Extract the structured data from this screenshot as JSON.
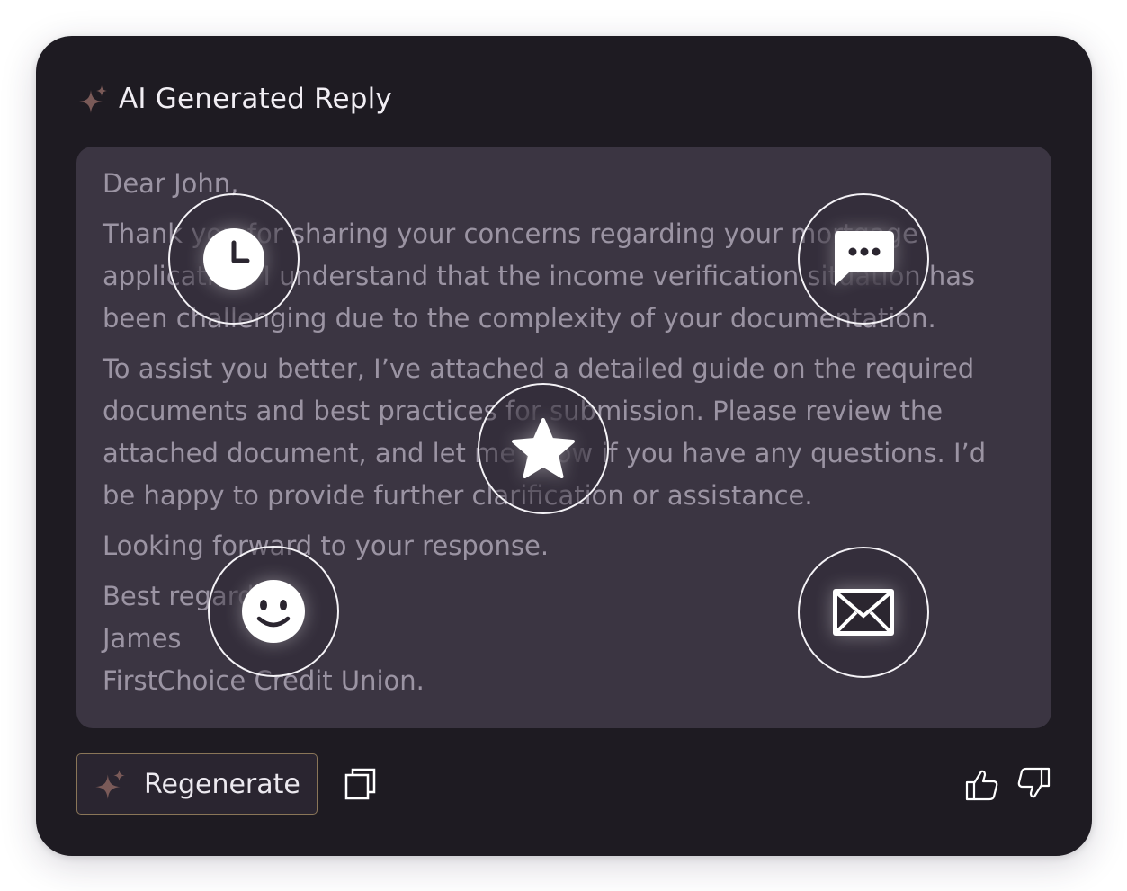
{
  "header": {
    "title": "AI Generated Reply"
  },
  "reply": {
    "greeting": "Dear John,",
    "paragraph_1": "Thank you for sharing your concerns regarding your mortgage application. I understand that the income verification situation has been challenging due to the complexity of your documentation.",
    "paragraph_2": "To assist you better, I’ve attached a detailed guide on the required documents and best practices for submission. Please review the attached document, and let me know if you have any questions. I’d be happy to provide further clarification or assistance.",
    "paragraph_3": "Looking forward to your response.",
    "closing": "Best regards,",
    "sender_name": "James",
    "sender_org": "FirstChoice Credit Union."
  },
  "feature_icons": [
    {
      "name": "clock-icon"
    },
    {
      "name": "chat-bubble-icon"
    },
    {
      "name": "star-icon"
    },
    {
      "name": "smiley-icon"
    },
    {
      "name": "envelope-icon"
    }
  ],
  "footer": {
    "regenerate_label": "Regenerate",
    "copy_icon": "copy-icon",
    "thumbs_up_icon": "thumbs-up-icon",
    "thumbs_down_icon": "thumbs-down-icon"
  },
  "colors": {
    "card_background": "#1e1b22",
    "reply_background": "#3b3542",
    "reply_text": "#9b94a3",
    "title_text": "#f1eef4",
    "sparkle_accent": "#7a5a58",
    "button_border": "#8a7658"
  }
}
